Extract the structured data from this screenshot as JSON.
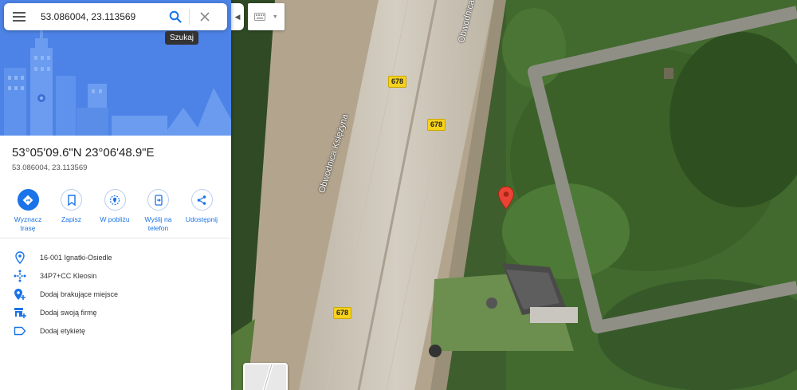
{
  "search": {
    "value": "53.086004, 23.113569",
    "tooltip": "Szukaj"
  },
  "icons": {
    "menu": "hamburger-menu-icon",
    "search": "magnifier-icon",
    "close": "close-x-icon",
    "collapse": "caret-left-icon",
    "keyboard": "keyboard-icon",
    "marker": "red-location-pin-icon"
  },
  "place": {
    "title": "53°05'09.6\"N 23°06'48.9\"E",
    "subtitle": "53.086004, 23.113569"
  },
  "actions": [
    {
      "label": "Wyznacz trasę",
      "icon": "directions-icon"
    },
    {
      "label": "Zapisz",
      "icon": "bookmark-icon"
    },
    {
      "label": "W pobliżu",
      "icon": "nearby-icon"
    },
    {
      "label": "Wyślij na telefon",
      "icon": "send-to-phone-icon"
    },
    {
      "label": "Udostępnij",
      "icon": "share-icon"
    }
  ],
  "info": [
    {
      "text": "16-001 Ignatki-Osiedle",
      "icon": "location-pin-icon"
    },
    {
      "text": "34P7+CC Kleosin",
      "icon": "plus-code-icon"
    },
    {
      "text": "Dodaj brakujące miejsce",
      "icon": "add-place-icon"
    },
    {
      "text": "Dodaj swoją firmę",
      "icon": "add-business-icon"
    },
    {
      "text": "Dodaj etykietę",
      "icon": "label-icon"
    }
  ],
  "map": {
    "road_name": "Obwodnica Księżyna",
    "route_number": "678"
  },
  "colors": {
    "accent": "#1a73e8",
    "hero": "#4d83e6",
    "marker": "#ea4335",
    "shield": "#f7d21a"
  }
}
